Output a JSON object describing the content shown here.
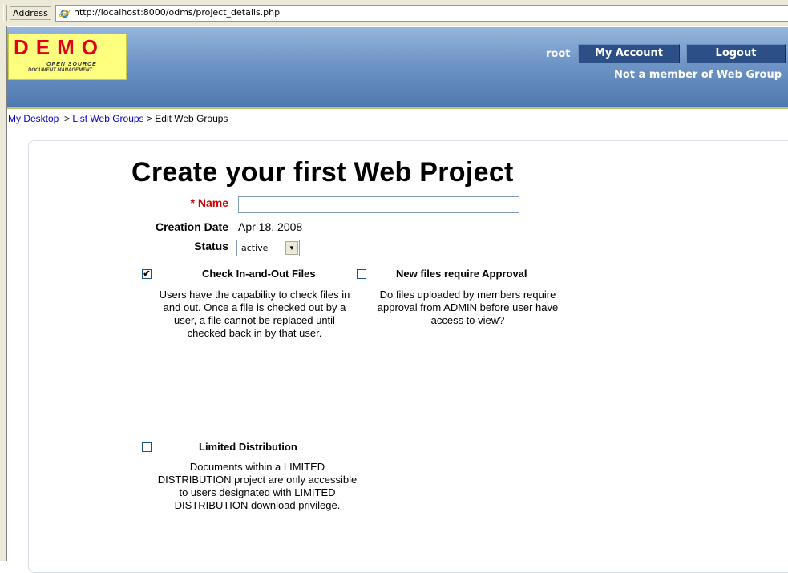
{
  "browser": {
    "address_label": "Address",
    "url": "http://localhost:8000/odms/project_details.php"
  },
  "header": {
    "logo_title": "DEMO",
    "logo_sub1": "OPEN   SOURCE",
    "logo_sub2": "DOCUMENT MANAGEMENT",
    "user": "root",
    "my_account": "My Account",
    "logout": "Logout",
    "member_note": "Not a member of Web Group"
  },
  "breadcrumb": {
    "my_desktop": "My Desktop",
    "sep": ">",
    "list_web_groups": "List Web Groups",
    "current": "Edit Web Groups"
  },
  "form": {
    "title": "Create your first Web Project",
    "name_label": "* Name",
    "name_value": "",
    "creation_date_label": "Creation Date",
    "creation_date_value": "Apr 18, 2008",
    "status_label": "Status",
    "status_value": "active"
  },
  "options": {
    "checkin": {
      "checked": true,
      "title": "Check In-and-Out Files",
      "description": "Users have the capability to check files in and out. Once a file is checked out by a user, a file cannot be replaced until checked back in by that user."
    },
    "approval": {
      "checked": false,
      "title": "New files require Approval",
      "description": "Do files uploaded by members require approval from ADMIN before user have access to view?"
    },
    "limited": {
      "checked": false,
      "title": "Limited Distribution",
      "description": "Documents within a LIMITED DISTRIBUTION project are only accessible to users designated with LIMITED DISTRIBUTION download privilege."
    }
  },
  "icons": {
    "ie": "internet-explorer-icon",
    "check_mark": "✔"
  },
  "colors": {
    "header_top": "#96b5db",
    "header_bottom": "#4e78b0",
    "header_accent_line": "#b6c86e",
    "button_bg": "#2b4f86",
    "logo_bg": "#ffff7f",
    "logo_text": "#e3001b",
    "required_label": "#cc0000",
    "link": "#0000cc"
  }
}
